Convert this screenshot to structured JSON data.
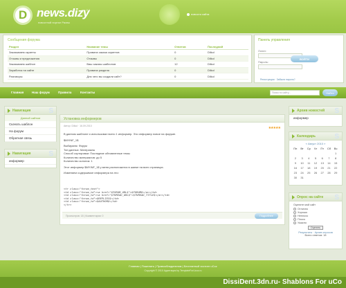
{
  "header": {
    "logo_letter": "D",
    "logo_text": "news.dizy",
    "version": "ver 2.0",
    "subtitle": "новостной портал Разны",
    "top_link": "новости сайта"
  },
  "forum": {
    "title": "Сообщения форума",
    "columns": [
      "Раздел",
      "Название темы",
      "Ответов",
      "Последний"
    ],
    "rows": [
      [
        "Заказываем скрипты",
        "Правила заказа скриптов",
        "0",
        "Dilkol"
      ],
      [
        "Отзывы и предложения",
        "Отзывы",
        "0",
        "Dilkol"
      ],
      [
        "Заказываем шаблон",
        "Ваш заказы шаблонов",
        "12",
        "Dilkol"
      ],
      [
        "Заработок на сайте",
        "Правила раздела",
        "0",
        "Dilkol"
      ],
      [
        "Разговоры",
        "Для чего вы создали сайт?",
        "0",
        "Dilkol"
      ]
    ]
  },
  "login": {
    "title": "Панель управления",
    "login_label": "Логин:",
    "password_label": "Пароль:",
    "button": "ВОЙТИ",
    "links": "Регистрация · Забыли пароль?"
  },
  "nav": {
    "items": [
      "Главная",
      "Наш форум",
      "Правила",
      "Контакты"
    ],
    "search_placeholder": "Поиск по сайту...",
    "search_button": "Найти"
  },
  "sidebar_left": {
    "nav_title": "Навигация",
    "nav_sub": "Данной сайтом",
    "nav_items": [
      "Скачать шаблон",
      "На форум",
      "Обратная связь"
    ],
    "nav2_title": "Навигация",
    "nav2_item": "информер"
  },
  "post": {
    "title": "Установка информеров",
    "meta": "Автор: Dilkol · 16.09.2010",
    "stars": "★★★★★",
    "body": [
      "В данном шаблоне я использовал всего 1 информер. Это информер новое на форуме.",
      "$MYINF_1$",
      "Выбираем: Форум",
      "Тип данных: Материалы",
      "Способ сортировки: Последние обновленные темы",
      "Количество материалов: до 5",
      "Количество колонок: 1",
      "Этот информер $MYINF_1$ у меня расположится в шапке на всех страницах.",
      "Изменяем содержимое информера на это:"
    ],
    "code": [
      "<tr class=\"forum_text\">",
      "<td class=\"forum_td\"><a href=\"$FORUM_URL$\">$FORUM$</a></td>",
      "<td class=\"forum_td\"><a href=\"$THREAD_URL$\">$THREAD_TITLE$</a></td>",
      "<td class=\"forum_td\">$REPLIES$</td>",
      "<td class=\"forum_td\">$AUTHOR$</td>",
      "</tr>"
    ],
    "foot_meta": "Просмотров: 18 | Комментарии: 0",
    "more": "Подробнее"
  },
  "sidebar_right": {
    "archive_title": "Архив новостей",
    "archive_item": "информер",
    "calendar_title": "Календарь",
    "calendar_month": "« Август 2010 »",
    "weekdays": [
      "Пн",
      "Вт",
      "Ср",
      "Чт",
      "Пт",
      "Сб",
      "Вс"
    ],
    "days": [
      "",
      "",
      "",
      "",
      "",
      "",
      "1",
      "2",
      "3",
      "4",
      "5",
      "6",
      "7",
      "8",
      "9",
      "10",
      "11",
      "12",
      "13",
      "14",
      "15",
      "16",
      "17",
      "18",
      "19",
      "20",
      "21",
      "22",
      "23",
      "24",
      "25",
      "26",
      "27",
      "28",
      "29",
      "30",
      "31",
      "",
      "",
      "",
      "",
      ""
    ],
    "poll_title": "Опрос на сайте",
    "poll_question": "Оцените мой сайт",
    "poll_options": [
      "Отлично",
      "Хорошо",
      "Неплохо",
      "Плохо",
      "Ужасно"
    ],
    "poll_button": "Оценить",
    "poll_links": "Результаты · Архив опросов",
    "poll_total": "Всего ответов: 18"
  },
  "footer": {
    "links": "Главная | Пожелать | Правообладателям | Бесплатный хостинг uCoz",
    "copyright": "Copyright © 2010 Адаптация by TemplateForUcoz.ru"
  },
  "watermark": "DissiDent.3dn.ru- Shablons For uCo"
}
